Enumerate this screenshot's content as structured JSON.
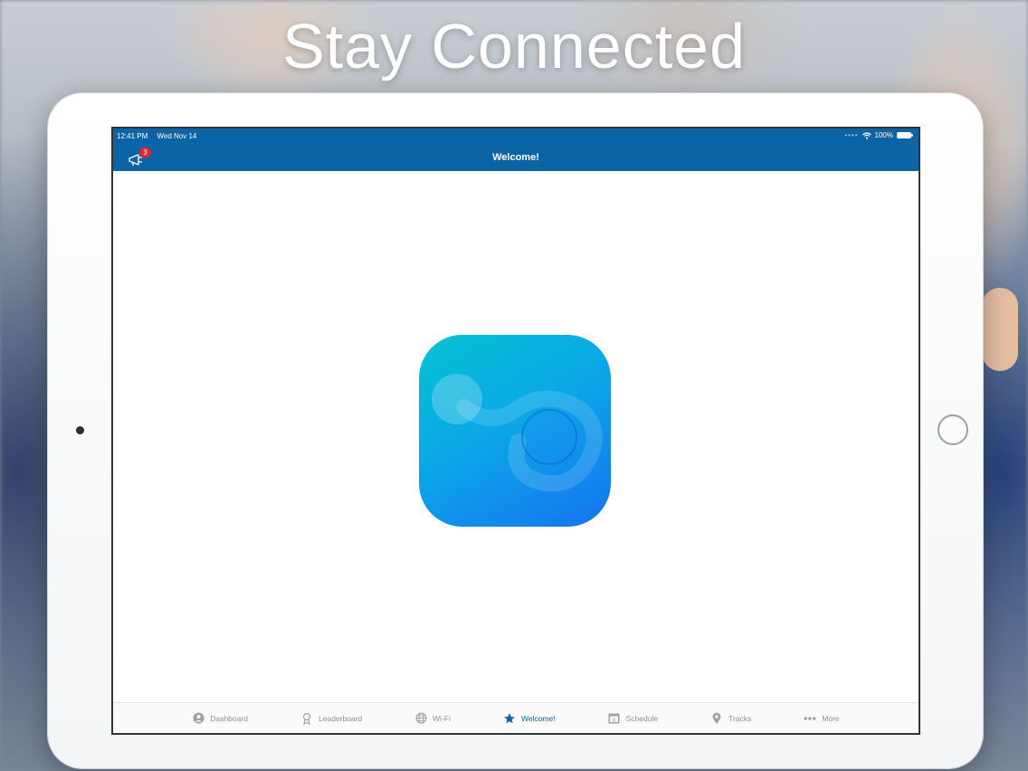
{
  "promo": {
    "headline": "Stay Connected"
  },
  "status_bar": {
    "time": "12:41 PM",
    "date": "Wed Nov 14",
    "battery": "100%"
  },
  "nav": {
    "title": "Welcome!",
    "announcement_badge": "3"
  },
  "tabs": [
    {
      "label": "Dashboard",
      "icon": "dashboard-icon"
    },
    {
      "label": "Leaderboard",
      "icon": "award-ribbon-icon"
    },
    {
      "label": "Wi-Fi",
      "icon": "globe-icon"
    },
    {
      "label": "Welcome!",
      "icon": "star-icon",
      "active": true
    },
    {
      "label": "Schedule",
      "icon": "calendar-icon"
    },
    {
      "label": "Tracks",
      "icon": "map-pin-icon"
    },
    {
      "label": "More",
      "icon": "more-dots-icon"
    }
  ],
  "colors": {
    "brand_blue": "#0a64a6",
    "badge_red": "#e0262b",
    "tab_inactive": "#8d9196",
    "app_icon_gradient_start": "#06c2d2",
    "app_icon_gradient_end": "#1673f2"
  }
}
